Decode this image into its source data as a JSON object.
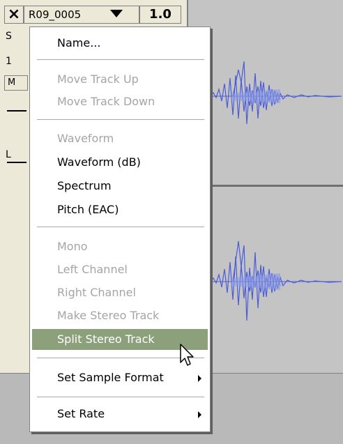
{
  "track": {
    "close_label": "×",
    "name": "R09_0005",
    "gain_value": "1.0",
    "side_letters": [
      "S",
      "1",
      "M",
      "L"
    ]
  },
  "menu": {
    "items": [
      {
        "label": "Name...",
        "enabled": true
      },
      {
        "label": "Move Track Up",
        "enabled": false
      },
      {
        "label": "Move Track Down",
        "enabled": false
      },
      {
        "label": "Waveform",
        "enabled": false
      },
      {
        "label": "Waveform (dB)",
        "enabled": true
      },
      {
        "label": "Spectrum",
        "enabled": true
      },
      {
        "label": "Pitch (EAC)",
        "enabled": true
      },
      {
        "label": "Mono",
        "enabled": false
      },
      {
        "label": "Left Channel",
        "enabled": false
      },
      {
        "label": "Right Channel",
        "enabled": false
      },
      {
        "label": "Make Stereo Track",
        "enabled": false
      },
      {
        "label": "Split Stereo Track",
        "enabled": true,
        "highlighted": true
      },
      {
        "label": "Set Sample Format",
        "enabled": true,
        "submenu": true
      },
      {
        "label": "Set Rate",
        "enabled": true,
        "submenu": true
      }
    ]
  },
  "colors": {
    "waveform": "#4a5cd6",
    "waveform_light": "#8a9ae6",
    "highlight": "#8da07c"
  }
}
